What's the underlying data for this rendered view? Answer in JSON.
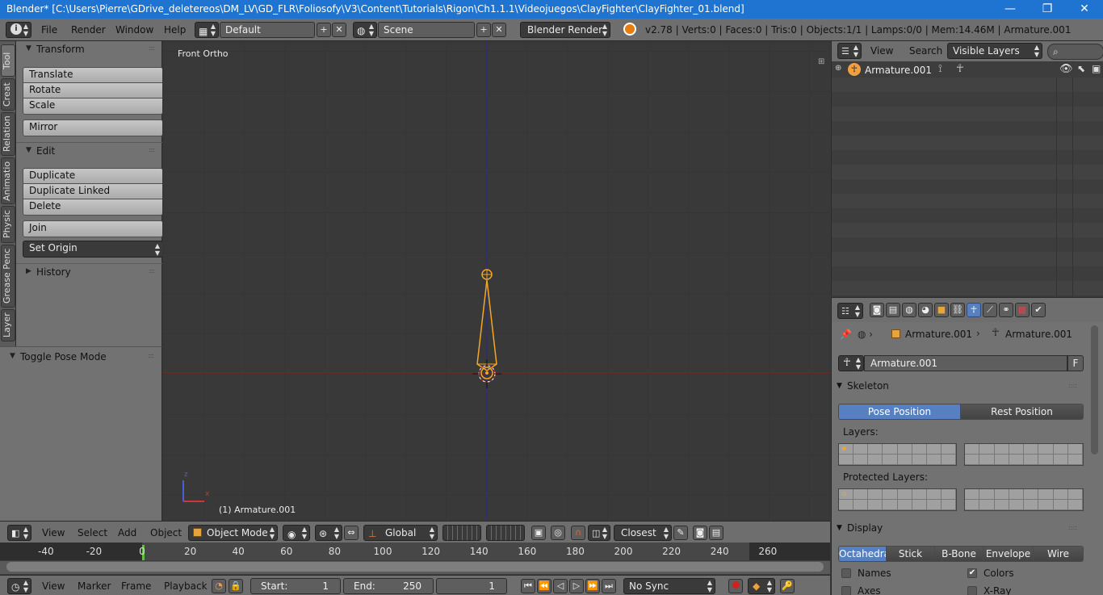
{
  "window": {
    "title": "Blender* [C:\\Users\\Pierre\\GDrive_deletereos\\DM_LV\\GD_FLR\\Foliosofy\\V3\\Content\\Tutorials\\Rigon\\Ch1.1.1\\Videojuegos\\ClayFighter\\ClayFighter_01.blend]",
    "minimize": "—",
    "restore": "❐",
    "close": "✕"
  },
  "info": {
    "menus": [
      "File",
      "Render",
      "Window",
      "Help"
    ],
    "layout": "Default",
    "scene": "Scene",
    "engine": "Blender Render",
    "stats": "v2.78 | Verts:0 | Faces:0 | Tris:0 | Objects:1/1 | Lamps:0/0 | Mem:14.46M | Armature.001"
  },
  "tabs": [
    "Tool",
    "Creat",
    "Relation",
    "Animatio",
    "Physic",
    "Grease Penc",
    "Layer"
  ],
  "toolshelf": {
    "transform_header": "Transform",
    "translate": "Translate",
    "rotate": "Rotate",
    "scale": "Scale",
    "mirror": "Mirror",
    "edit_header": "Edit",
    "duplicate": "Duplicate",
    "duplicate_linked": "Duplicate Linked",
    "delete": "Delete",
    "join": "Join",
    "set_origin": "Set Origin",
    "history_header": "History",
    "toggle_pose_header": "Toggle Pose Mode"
  },
  "viewport": {
    "view_name": "Front Ortho",
    "object_label": "(1) Armature.001",
    "axis_z": "z",
    "axis_x": "x",
    "accent": "#f5a623",
    "x_axis_color": "#8b1e1e",
    "z_axis_color": "#2b2b8f"
  },
  "viewheader": {
    "menus": [
      "View",
      "Select",
      "Add",
      "Object"
    ],
    "mode": "Object Mode",
    "orientation": "Global",
    "snap": "Closest"
  },
  "timeline": {
    "ticks": [
      "-40",
      "-20",
      "0",
      "20",
      "40",
      "60",
      "80",
      "100",
      "120",
      "140",
      "160",
      "180",
      "200",
      "220",
      "240",
      "260"
    ],
    "menus": [
      "View",
      "Marker",
      "Frame",
      "Playback"
    ],
    "start_label": "Start:",
    "start_value": "1",
    "end_label": "End:",
    "end_value": "250",
    "current": "1",
    "sync": "No Sync"
  },
  "outliner": {
    "menus": [
      "View",
      "Search"
    ],
    "filter": "Visible Layers",
    "item": "Armature.001"
  },
  "properties": {
    "crumb_object": "Armature.001",
    "crumb_data": "Armature.001",
    "datablock": "Armature.001",
    "fake_user": "F",
    "skeleton_header": "Skeleton",
    "pose_position": "Pose Position",
    "rest_position": "Rest Position",
    "layers_label": "Layers:",
    "protected_label": "Protected Layers:",
    "display_header": "Display",
    "display_types": [
      "Octahedral",
      "Stick",
      "B-Bone",
      "Envelope",
      "Wire"
    ],
    "names": "Names",
    "colors": "Colors",
    "axes": "Axes",
    "xray": "X-Ray"
  }
}
